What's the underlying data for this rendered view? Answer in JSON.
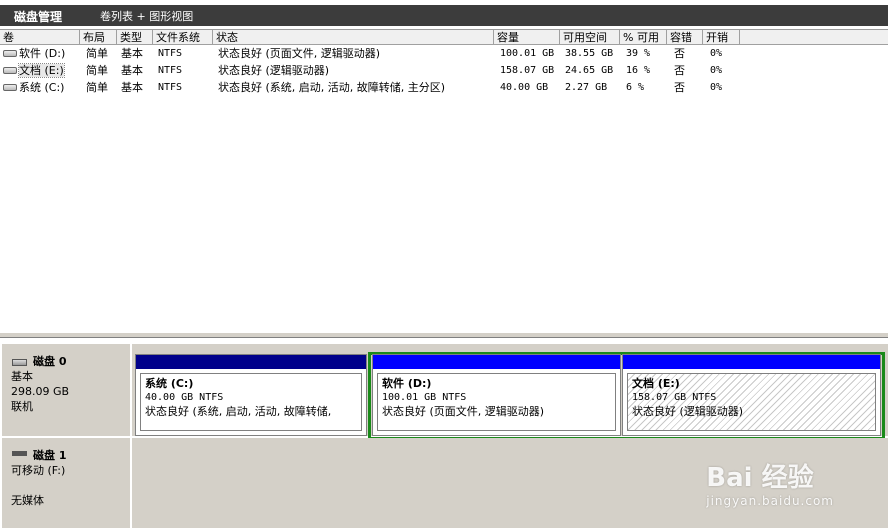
{
  "header": {
    "title": "磁盘管理",
    "view": "卷列表 + 图形视图"
  },
  "volume_table": {
    "columns": [
      "卷",
      "布局",
      "类型",
      "文件系统",
      "状态",
      "容量",
      "可用空间",
      "% 可用",
      "容错",
      "开销"
    ],
    "rows": [
      {
        "name": "软件 (D:)",
        "layout": "简单",
        "type": "基本",
        "fs": "NTFS",
        "status": "状态良好 (页面文件, 逻辑驱动器)",
        "capacity": "100.01 GB",
        "free": "38.55 GB",
        "pct": "39 %",
        "fault": "否",
        "overhead": "0%"
      },
      {
        "name": "文档 (E:)",
        "layout": "简单",
        "type": "基本",
        "fs": "NTFS",
        "status": "状态良好 (逻辑驱动器)",
        "capacity": "158.07 GB",
        "free": "24.65 GB",
        "pct": "16 %",
        "fault": "否",
        "overhead": "0%"
      },
      {
        "name": "系统 (C:)",
        "layout": "简单",
        "type": "基本",
        "fs": "NTFS",
        "status": "状态良好 (系统, 启动, 活动, 故障转储, 主分区)",
        "capacity": "40.00 GB",
        "free": "2.27 GB",
        "pct": "6 %",
        "fault": "否",
        "overhead": "0%"
      }
    ]
  },
  "disks": [
    {
      "name": "磁盘 0",
      "type": "基本",
      "size": "298.09 GB",
      "state": "联机",
      "partitions": [
        {
          "title": "系统  (C:)",
          "size": "40.00 GB NTFS",
          "status": "状态良好 (系统, 启动, 活动, 故障转储,"
        },
        {
          "title": "软件  (D:)",
          "size": "100.01 GB NTFS",
          "status": "状态良好 (页面文件, 逻辑驱动器)"
        },
        {
          "title": "文档  (E:)",
          "size": "158.07 GB NTFS",
          "status": "状态良好 (逻辑驱动器)"
        }
      ]
    },
    {
      "name": "磁盘 1",
      "type": "可移动 (F:)",
      "state": "无媒体"
    }
  ],
  "watermark": {
    "brand": "Bai 经验",
    "url": "jingyan.baidu.com"
  },
  "colors": {
    "primary_partition": "#00008b",
    "logical_partition": "#0000ff",
    "extended_frame": "#1a8a1a"
  }
}
